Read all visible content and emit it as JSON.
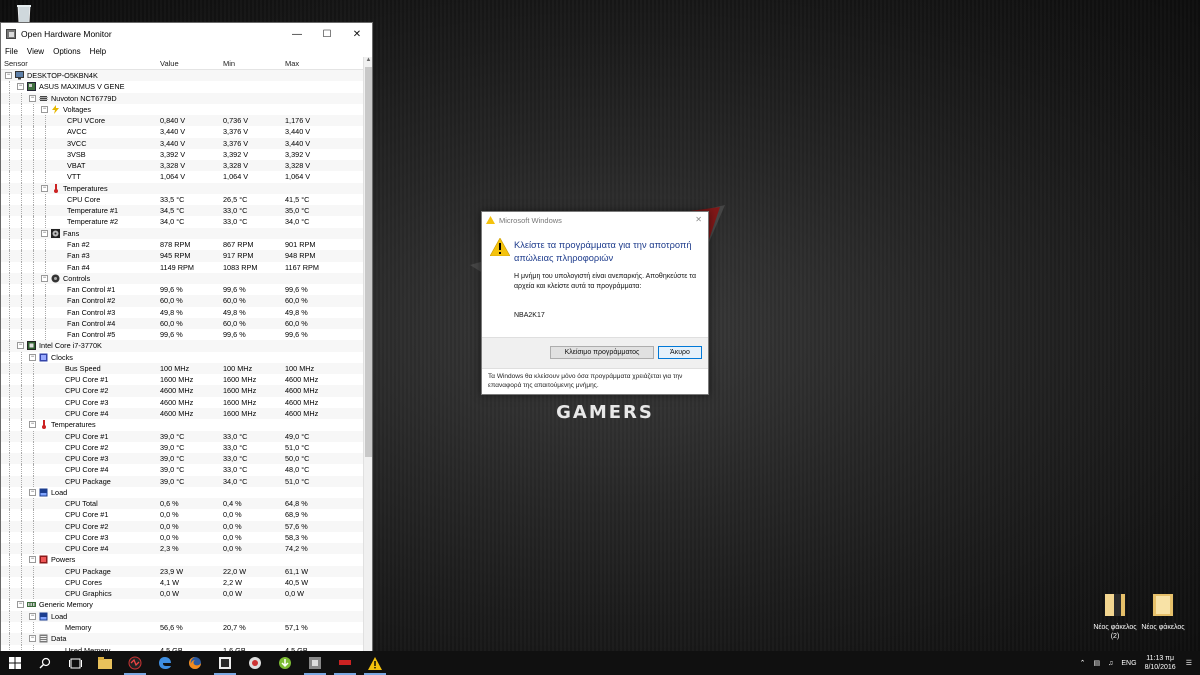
{
  "ohm": {
    "title": "Open Hardware Monitor",
    "menu": [
      "File",
      "View",
      "Options",
      "Help"
    ],
    "columns": {
      "sensor": "Sensor",
      "value": "Value",
      "min": "Min",
      "max": "Max"
    },
    "rows": [
      {
        "level": 0,
        "exp": "-",
        "icon": "computer-icon",
        "label": "DESKTOP-O5KBN4K",
        "value": "",
        "min": "",
        "max": ""
      },
      {
        "level": 1,
        "exp": "-",
        "icon": "motherboard-icon",
        "label": "ASUS MAXIMUS V GENE",
        "value": "",
        "min": "",
        "max": ""
      },
      {
        "level": 2,
        "exp": "-",
        "icon": "chip-icon",
        "label": "Nuvoton NCT6779D",
        "value": "",
        "min": "",
        "max": ""
      },
      {
        "level": 3,
        "exp": "-",
        "icon": "voltage-icon",
        "label": "Voltages",
        "value": "",
        "min": "",
        "max": ""
      },
      {
        "level": 4,
        "exp": "",
        "icon": "",
        "label": "CPU VCore",
        "value": "0,840 V",
        "min": "0,736 V",
        "max": "1,176 V"
      },
      {
        "level": 4,
        "exp": "",
        "icon": "",
        "label": "AVCC",
        "value": "3,440 V",
        "min": "3,376 V",
        "max": "3,440 V"
      },
      {
        "level": 4,
        "exp": "",
        "icon": "",
        "label": "3VCC",
        "value": "3,440 V",
        "min": "3,376 V",
        "max": "3,440 V"
      },
      {
        "level": 4,
        "exp": "",
        "icon": "",
        "label": "3VSB",
        "value": "3,392 V",
        "min": "3,392 V",
        "max": "3,392 V"
      },
      {
        "level": 4,
        "exp": "",
        "icon": "",
        "label": "VBAT",
        "value": "3,328 V",
        "min": "3,328 V",
        "max": "3,328 V"
      },
      {
        "level": 4,
        "exp": "",
        "icon": "",
        "label": "VTT",
        "value": "1,064 V",
        "min": "1,064 V",
        "max": "1,064 V"
      },
      {
        "level": 3,
        "exp": "-",
        "icon": "thermometer-icon",
        "label": "Temperatures",
        "value": "",
        "min": "",
        "max": ""
      },
      {
        "level": 4,
        "exp": "",
        "icon": "",
        "label": "CPU Core",
        "value": "33,5 °C",
        "min": "26,5 °C",
        "max": "41,5 °C"
      },
      {
        "level": 4,
        "exp": "",
        "icon": "",
        "label": "Temperature #1",
        "value": "34,5 °C",
        "min": "33,0 °C",
        "max": "35,0 °C"
      },
      {
        "level": 4,
        "exp": "",
        "icon": "",
        "label": "Temperature #2",
        "value": "34,0 °C",
        "min": "33,0 °C",
        "max": "34,0 °C"
      },
      {
        "level": 3,
        "exp": "-",
        "icon": "fan-icon",
        "label": "Fans",
        "value": "",
        "min": "",
        "max": ""
      },
      {
        "level": 4,
        "exp": "",
        "icon": "",
        "label": "Fan #2",
        "value": "878 RPM",
        "min": "867 RPM",
        "max": "901 RPM"
      },
      {
        "level": 4,
        "exp": "",
        "icon": "",
        "label": "Fan #3",
        "value": "945 RPM",
        "min": "917 RPM",
        "max": "948 RPM"
      },
      {
        "level": 4,
        "exp": "",
        "icon": "",
        "label": "Fan #4",
        "value": "1149 RPM",
        "min": "1083 RPM",
        "max": "1167 RPM"
      },
      {
        "level": 3,
        "exp": "-",
        "icon": "control-icon",
        "label": "Controls",
        "value": "",
        "min": "",
        "max": ""
      },
      {
        "level": 4,
        "exp": "",
        "icon": "",
        "label": "Fan Control #1",
        "value": "99,6 %",
        "min": "99,6 %",
        "max": "99,6 %"
      },
      {
        "level": 4,
        "exp": "",
        "icon": "",
        "label": "Fan Control #2",
        "value": "60,0 %",
        "min": "60,0 %",
        "max": "60,0 %"
      },
      {
        "level": 4,
        "exp": "",
        "icon": "",
        "label": "Fan Control #3",
        "value": "49,8 %",
        "min": "49,8 %",
        "max": "49,8 %"
      },
      {
        "level": 4,
        "exp": "",
        "icon": "",
        "label": "Fan Control #4",
        "value": "60,0 %",
        "min": "60,0 %",
        "max": "60,0 %"
      },
      {
        "level": 4,
        "exp": "",
        "icon": "",
        "label": "Fan Control #5",
        "value": "99,6 %",
        "min": "99,6 %",
        "max": "99,6 %"
      },
      {
        "level": 1,
        "exp": "-",
        "icon": "cpu-icon",
        "label": "Intel Core i7-3770K",
        "value": "",
        "min": "",
        "max": ""
      },
      {
        "level": 2,
        "exp": "-",
        "icon": "clock-icon",
        "label": "Clocks",
        "value": "",
        "min": "",
        "max": ""
      },
      {
        "level": 3,
        "exp": "",
        "icon": "",
        "label": "Bus Speed",
        "value": "100 MHz",
        "min": "100 MHz",
        "max": "100 MHz"
      },
      {
        "level": 3,
        "exp": "",
        "icon": "",
        "label": "CPU Core #1",
        "value": "1600 MHz",
        "min": "1600 MHz",
        "max": "4600 MHz"
      },
      {
        "level": 3,
        "exp": "",
        "icon": "",
        "label": "CPU Core #2",
        "value": "4600 MHz",
        "min": "1600 MHz",
        "max": "4600 MHz"
      },
      {
        "level": 3,
        "exp": "",
        "icon": "",
        "label": "CPU Core #3",
        "value": "4600 MHz",
        "min": "1600 MHz",
        "max": "4600 MHz"
      },
      {
        "level": 3,
        "exp": "",
        "icon": "",
        "label": "CPU Core #4",
        "value": "4600 MHz",
        "min": "1600 MHz",
        "max": "4600 MHz"
      },
      {
        "level": 2,
        "exp": "-",
        "icon": "thermometer-icon",
        "label": "Temperatures",
        "value": "",
        "min": "",
        "max": ""
      },
      {
        "level": 3,
        "exp": "",
        "icon": "",
        "label": "CPU Core #1",
        "value": "39,0 °C",
        "min": "33,0 °C",
        "max": "49,0 °C"
      },
      {
        "level": 3,
        "exp": "",
        "icon": "",
        "label": "CPU Core #2",
        "value": "39,0 °C",
        "min": "33,0 °C",
        "max": "51,0 °C"
      },
      {
        "level": 3,
        "exp": "",
        "icon": "",
        "label": "CPU Core #3",
        "value": "39,0 °C",
        "min": "33,0 °C",
        "max": "50,0 °C"
      },
      {
        "level": 3,
        "exp": "",
        "icon": "",
        "label": "CPU Core #4",
        "value": "39,0 °C",
        "min": "33,0 °C",
        "max": "48,0 °C"
      },
      {
        "level": 3,
        "exp": "",
        "icon": "",
        "label": "CPU Package",
        "value": "39,0 °C",
        "min": "34,0 °C",
        "max": "51,0 °C"
      },
      {
        "level": 2,
        "exp": "-",
        "icon": "load-icon",
        "label": "Load",
        "value": "",
        "min": "",
        "max": ""
      },
      {
        "level": 3,
        "exp": "",
        "icon": "",
        "label": "CPU Total",
        "value": "0,6 %",
        "min": "0,4 %",
        "max": "64,8 %"
      },
      {
        "level": 3,
        "exp": "",
        "icon": "",
        "label": "CPU Core #1",
        "value": "0,0 %",
        "min": "0,0 %",
        "max": "68,9 %"
      },
      {
        "level": 3,
        "exp": "",
        "icon": "",
        "label": "CPU Core #2",
        "value": "0,0 %",
        "min": "0,0 %",
        "max": "57,6 %"
      },
      {
        "level": 3,
        "exp": "",
        "icon": "",
        "label": "CPU Core #3",
        "value": "0,0 %",
        "min": "0,0 %",
        "max": "58,3 %"
      },
      {
        "level": 3,
        "exp": "",
        "icon": "",
        "label": "CPU Core #4",
        "value": "2,3 %",
        "min": "0,0 %",
        "max": "74,2 %"
      },
      {
        "level": 2,
        "exp": "-",
        "icon": "power-icon",
        "label": "Powers",
        "value": "",
        "min": "",
        "max": ""
      },
      {
        "level": 3,
        "exp": "",
        "icon": "",
        "label": "CPU Package",
        "value": "23,9 W",
        "min": "22,0 W",
        "max": "61,1 W"
      },
      {
        "level": 3,
        "exp": "",
        "icon": "",
        "label": "CPU Cores",
        "value": "4,1 W",
        "min": "2,2 W",
        "max": "40,5 W"
      },
      {
        "level": 3,
        "exp": "",
        "icon": "",
        "label": "CPU Graphics",
        "value": "0,0 W",
        "min": "0,0 W",
        "max": "0,0 W"
      },
      {
        "level": 1,
        "exp": "-",
        "icon": "memory-icon",
        "label": "Generic Memory",
        "value": "",
        "min": "",
        "max": ""
      },
      {
        "level": 2,
        "exp": "-",
        "icon": "load-icon",
        "label": "Load",
        "value": "",
        "min": "",
        "max": ""
      },
      {
        "level": 3,
        "exp": "",
        "icon": "",
        "label": "Memory",
        "value": "56,6 %",
        "min": "20,7 %",
        "max": "57,1 %"
      },
      {
        "level": 2,
        "exp": "-",
        "icon": "data-icon",
        "label": "Data",
        "value": "",
        "min": "",
        "max": ""
      },
      {
        "level": 3,
        "exp": "",
        "icon": "",
        "label": "Used Memory",
        "value": "4,5 GB",
        "min": "1,6 GB",
        "max": "4,5 GB"
      }
    ]
  },
  "dialog": {
    "title": "Microsoft Windows",
    "heading": "Κλείστε τα προγράμματα για την αποτροπή απώλειας πληροφοριών",
    "body": "Η μνήμη του υπολογιστή είναι ανεπαρκής. Αποθηκεύστε τα αρχεία και κλείστε αυτά τα προγράμματα:",
    "app": "NBA2K17",
    "close_programs_label": "Κλείσιμο προγράμματος",
    "cancel_label": "Άκυρο",
    "footer": "Τα Windows θα κλείσουν μόνο όσα προγράμματα χρειάζεται για την επαναφορά της απαιτούμενης μνήμης."
  },
  "desktop": {
    "wallpaper_text": "GAMERS",
    "folders": [
      {
        "label": "Νέος φάκελος (2)"
      },
      {
        "label": "Νέος φάκελος"
      }
    ]
  },
  "taskbar": {
    "items": [
      "start-icon",
      "search-icon",
      "task-view-icon",
      "folder-icon",
      "hwmonitor-icon",
      "edge-icon",
      "firefox-icon",
      "cpuz-icon",
      "steam-icon",
      "torrent-icon",
      "ohm-icon",
      "nba2k17-icon",
      "warning-icon"
    ],
    "lang": "ENG",
    "time": "11:13 πμ",
    "date": "8/10/2016"
  },
  "colors": {
    "accent": "#0078d7",
    "dialog_heading": "#1e3c8c"
  }
}
